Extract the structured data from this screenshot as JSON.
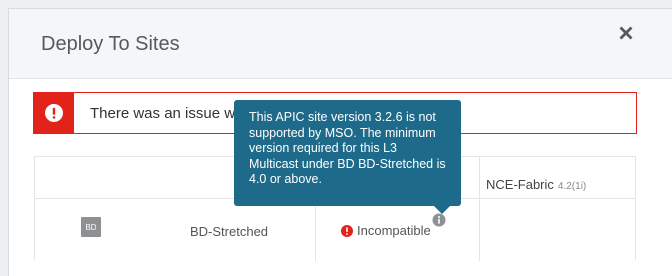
{
  "modal": {
    "title": "Deploy To Sites"
  },
  "alert": {
    "message": "There was an issue w"
  },
  "table": {
    "site": {
      "name": "NCE-Fabric",
      "version": "4.2(1i)"
    },
    "row": {
      "badge": "BD",
      "name": "BD-Stretched",
      "status": "Incompatible"
    }
  },
  "tooltip": {
    "lines": [
      "This APIC site version 3.2.6 is not",
      "supported by MSO. The minimum",
      "version required for this L3",
      "Multicast under BD BD-Stretched is",
      "4.0 or above."
    ]
  },
  "colors": {
    "error": "#e2231a",
    "tooltip": "#1d6a8a",
    "badge": "#8e9194"
  },
  "icons": {
    "close": "close-icon",
    "alert": "exclamation-circle-icon",
    "status": "error-circle-icon",
    "info": "info-icon"
  }
}
